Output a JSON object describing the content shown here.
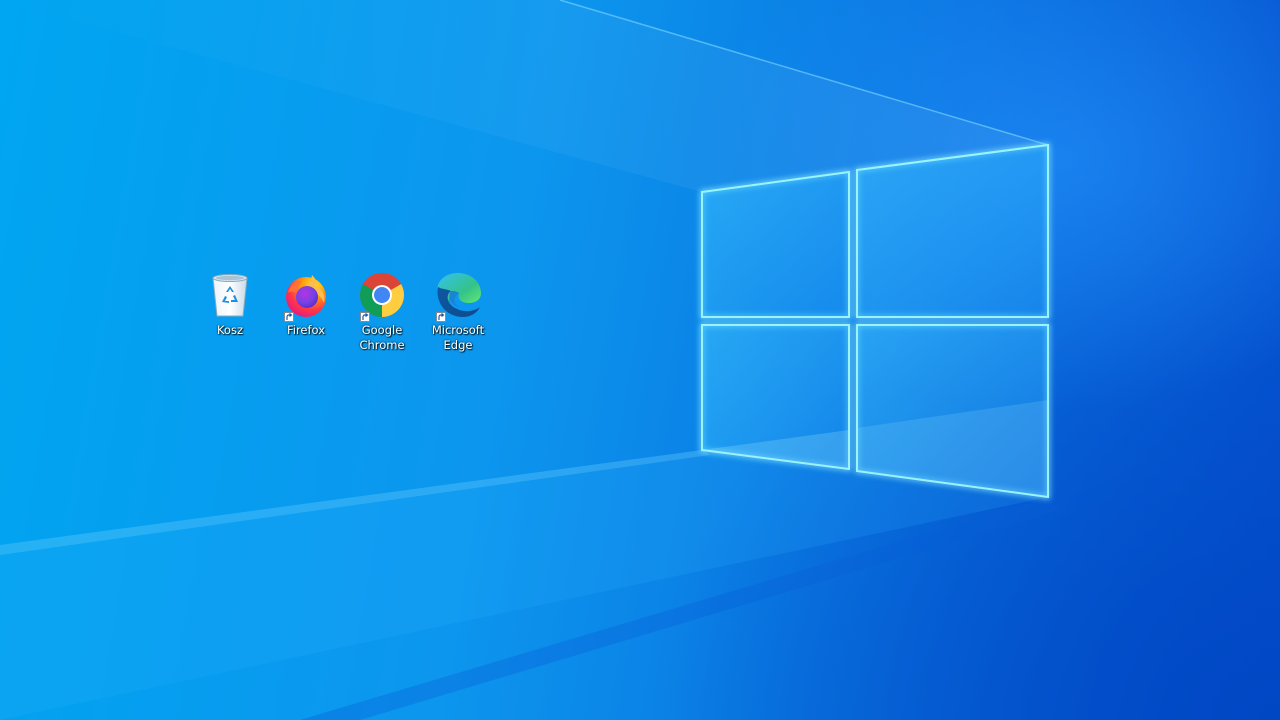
{
  "desktop": {
    "icons": [
      {
        "label": "Kosz",
        "icon": "recycle-bin-icon",
        "shortcut": false
      },
      {
        "label": "Firefox",
        "icon": "firefox-icon",
        "shortcut": true
      },
      {
        "label": "Google Chrome",
        "icon": "chrome-icon",
        "shortcut": true
      },
      {
        "label": "Microsoft Edge",
        "icon": "edge-icon",
        "shortcut": true
      }
    ]
  },
  "colors": {
    "wallpaper_left": "#00a6f1",
    "wallpaper_right": "#0650d0",
    "label_text": "#ffffff"
  }
}
